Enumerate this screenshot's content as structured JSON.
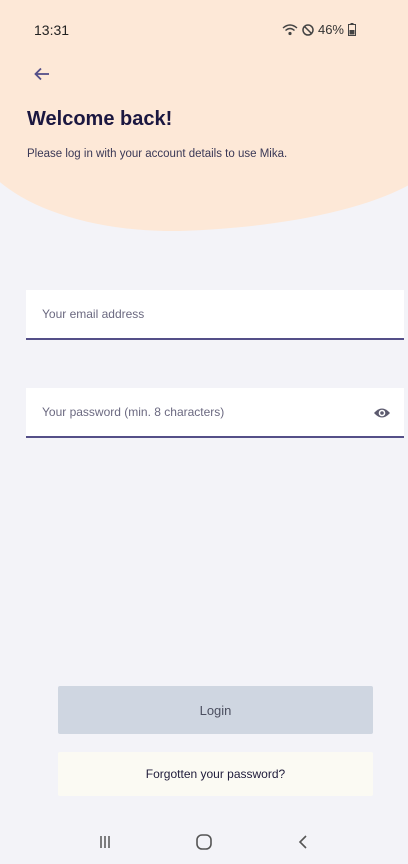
{
  "status_bar": {
    "time": "13:31",
    "battery": "46%",
    "icons": [
      "wifi-icon",
      "do-not-disturb-icon",
      "battery-icon"
    ]
  },
  "header": {
    "back_icon": "back-arrow-icon",
    "title": "Welcome back!",
    "subtitle": "Please log in with your account details to use Mika."
  },
  "form": {
    "email": {
      "placeholder": "Your email address",
      "value": ""
    },
    "password": {
      "placeholder": "Your password (min. 8 characters)",
      "value": "",
      "toggle_icon": "eye-icon"
    }
  },
  "actions": {
    "login_label": "Login",
    "forgot_label": "Forgotten your password?"
  },
  "navigation": {
    "buttons": [
      "recent-apps-icon",
      "home-icon",
      "back-icon"
    ]
  },
  "colors": {
    "accent": "#544f88",
    "header_background": "#fde8d7",
    "page_background": "#f3f3f8",
    "login_button": "#cfd6e1"
  }
}
